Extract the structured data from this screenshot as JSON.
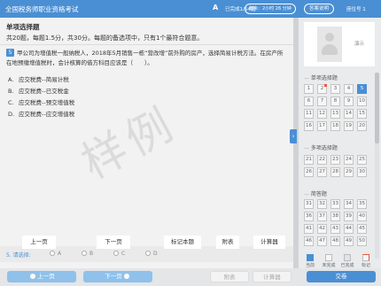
{
  "header": {
    "title": "全国税务师职业资格考试",
    "font_icon_label": "A",
    "done_count": "已完成1/54题",
    "timer": "剩余：2小时 26 分钟",
    "answer_sheet": "答案说明",
    "seat": "座位号 1"
  },
  "section": {
    "title": "单项选择题",
    "desc": "共20题，每题1.5分，共30分。每题的备选项中，只有1个最符合题意。"
  },
  "question": {
    "number": "5",
    "text": "甲公司为增值税一般纳税人，2018年5月销售一栋“营改增”前外购的房产，选择简易计税方法。在房产所在地预缴增值税时，会计核算的借方科目应该是（　　）。",
    "options": [
      {
        "letter": "A.",
        "text": "应交税费--简易计税"
      },
      {
        "letter": "B.",
        "text": "应交税费--已交税金"
      },
      {
        "letter": "C.",
        "text": "应交税费--预交增值税"
      },
      {
        "letter": "D.",
        "text": "应交税费--应交增值税"
      }
    ]
  },
  "watermark": "样例",
  "answer": {
    "label": "5. 请选择:",
    "choices": [
      "A",
      "B",
      "C",
      "D"
    ]
  },
  "callouts": {
    "prev": "上一页",
    "next": "下一页",
    "mark": "标记本题",
    "attach": "附表",
    "calc": "计算器"
  },
  "buttons": {
    "prev": "上一页",
    "next": "下一页",
    "attach": "附表",
    "calc": "计算器",
    "submit": "交卷"
  },
  "panel": {
    "name": "演示",
    "groups": [
      {
        "label": "单项选择题",
        "numbers": [
          "1",
          "2",
          "3",
          "4",
          "5",
          "6",
          "7",
          "8",
          "9",
          "10",
          "11",
          "12",
          "13",
          "14",
          "15",
          "16",
          "17",
          "18",
          "19",
          "20"
        ]
      },
      {
        "label": "多项选择题",
        "numbers": [
          "21",
          "22",
          "23",
          "24",
          "25",
          "26",
          "27",
          "28",
          "29",
          "30"
        ]
      },
      {
        "label": "简答题",
        "numbers": [
          "31",
          "32",
          "33",
          "34",
          "35",
          "36",
          "37",
          "38",
          "39",
          "40",
          "41",
          "42",
          "43",
          "44",
          "45",
          "46",
          "47",
          "48",
          "49",
          "50"
        ]
      }
    ],
    "current": "5",
    "flagged": [
      "2"
    ],
    "legend": [
      "当前",
      "未完成",
      "已完成",
      "标记"
    ]
  },
  "colors": {
    "accent": "#4a8fd4",
    "flag": "#e8553f"
  }
}
